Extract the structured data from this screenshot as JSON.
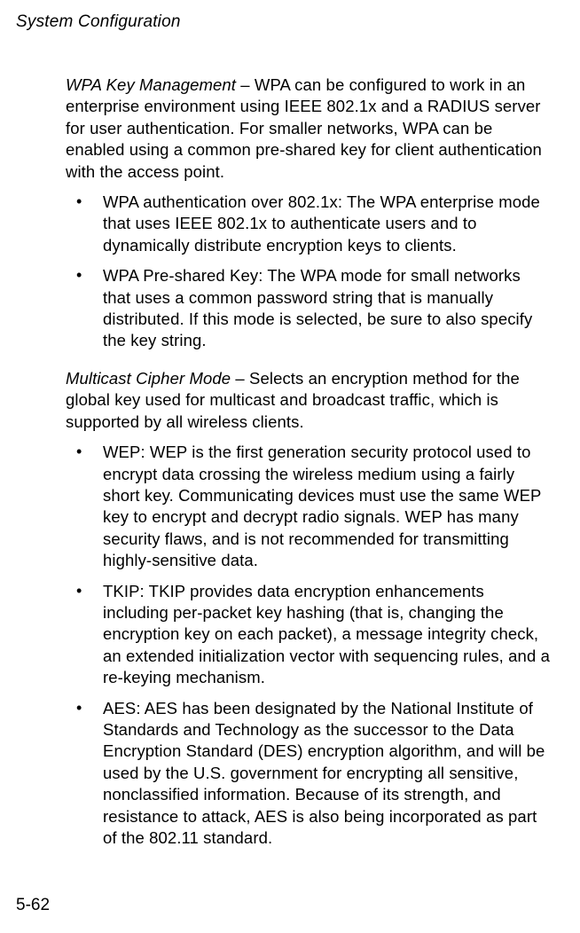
{
  "header": "System Configuration",
  "section1": {
    "lead": "WPA Key Management",
    "text": " – WPA can be configured to work in an enterprise environment using IEEE 802.1x and a RADIUS server for user authentication. For smaller networks, WPA can be enabled using a common pre-shared key for client authentication with the access point.",
    "bullets": [
      "WPA authentication over 802.1x: The WPA enterprise mode that uses IEEE 802.1x to authenticate users and to dynamically distribute encryption keys to clients.",
      "WPA Pre-shared Key: The WPA mode for small networks that uses a common password string that is manually distributed. If this mode is selected, be sure to also specify the key string."
    ]
  },
  "section2": {
    "lead": "Multicast Cipher Mode",
    "text": " – Selects an encryption method for the global key used for multicast and broadcast traffic, which is supported by all wireless clients.",
    "bullets": [
      "WEP: WEP is the first generation security protocol used to encrypt data crossing the wireless medium using a fairly short key. Communicating devices must use the same WEP key to encrypt and decrypt radio signals. WEP has many security flaws, and is not recommended for transmitting highly-sensitive data.",
      "TKIP: TKIP provides data encryption enhancements including per-packet key hashing (that is, changing the encryption key on each packet), a message integrity check, an extended initialization vector with sequencing rules, and a re-keying mechanism.",
      "AES: AES has been designated by the National Institute of Standards and Technology as the successor to the Data Encryption Standard (DES) encryption algorithm, and will be used by the U.S. government for encrypting all sensitive, nonclassified information. Because of its strength, and resistance to attack, AES is also being incorporated as part of the 802.11 standard."
    ]
  },
  "pageNumber": "5-62"
}
